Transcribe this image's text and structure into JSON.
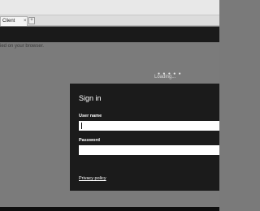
{
  "browser": {
    "tab_label": "Client",
    "tab_close": "×",
    "new_tab": "+"
  },
  "page": {
    "notice_text": "ied on your browser.",
    "loading_text": "Loading...",
    "loading_dots": "● ● ● ● ●"
  },
  "dialog": {
    "title": "Sign in",
    "username_label": "User name",
    "username_value": "",
    "password_label": "Password",
    "password_value": "",
    "privacy_link": "Privacy policy"
  }
}
